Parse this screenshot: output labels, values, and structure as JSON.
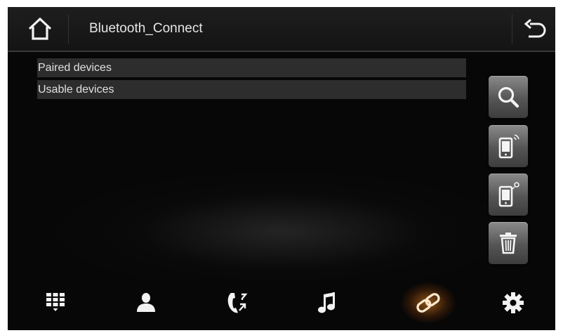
{
  "header": {
    "title": "Bluetooth_Connect",
    "home_icon": "home-icon",
    "back_icon": "back-arrow-icon"
  },
  "device_sections": [
    {
      "label": "Paired devices"
    },
    {
      "label": "Usable devices"
    }
  ],
  "side_actions": [
    {
      "icon": "search-icon"
    },
    {
      "icon": "phone-signal-icon"
    },
    {
      "icon": "phone-disconnect-icon"
    },
    {
      "icon": "trash-icon"
    }
  ],
  "bottom_nav": {
    "active_index": 4,
    "items": [
      {
        "icon": "dialpad-icon"
      },
      {
        "icon": "contacts-icon"
      },
      {
        "icon": "call-log-icon"
      },
      {
        "icon": "music-icon"
      },
      {
        "icon": "link-icon"
      },
      {
        "icon": "settings-icon"
      }
    ]
  },
  "colors": {
    "background": "#070707",
    "header": "#1a1a1a",
    "list_header": "#2d2d2d",
    "active_glow": "#ff9628"
  }
}
